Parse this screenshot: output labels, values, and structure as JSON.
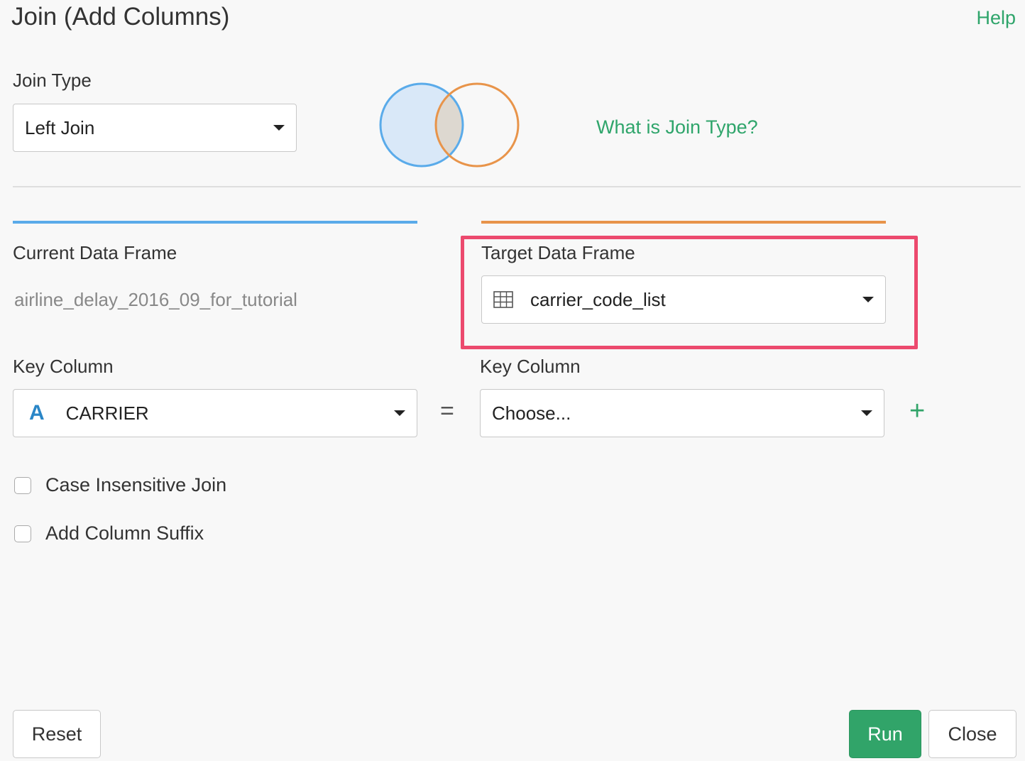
{
  "header": {
    "title": "Join (Add Columns)",
    "help_label": "Help"
  },
  "join_type": {
    "label": "Join Type",
    "selected": "Left Join",
    "help_link": "What is Join Type?",
    "venn_colors": {
      "left": "#5aabea",
      "right": "#e8944a",
      "left_fill": "#d9e8f8",
      "overlap_fill": "#ddd8d0"
    }
  },
  "current": {
    "label": "Current Data Frame",
    "name": "airline_delay_2016_09_for_tutorial",
    "key_label": "Key Column",
    "key_type_icon": "A",
    "key_value": "CARRIER"
  },
  "equals_sign": "=",
  "target": {
    "label": "Target Data Frame",
    "icon": "table-icon",
    "selected": "carrier_code_list",
    "key_label": "Key Column",
    "key_value": "Choose..."
  },
  "add_key_label": "+",
  "options": [
    {
      "label": "Case Insensitive Join",
      "checked": false
    },
    {
      "label": "Add Column Suffix",
      "checked": false
    }
  ],
  "footer": {
    "reset_label": "Reset",
    "run_label": "Run",
    "close_label": "Close"
  },
  "colors": {
    "accent_green": "#31a469",
    "highlight": "#ec4a6e",
    "current_bar": "#5aabea",
    "target_bar": "#e8944a"
  }
}
